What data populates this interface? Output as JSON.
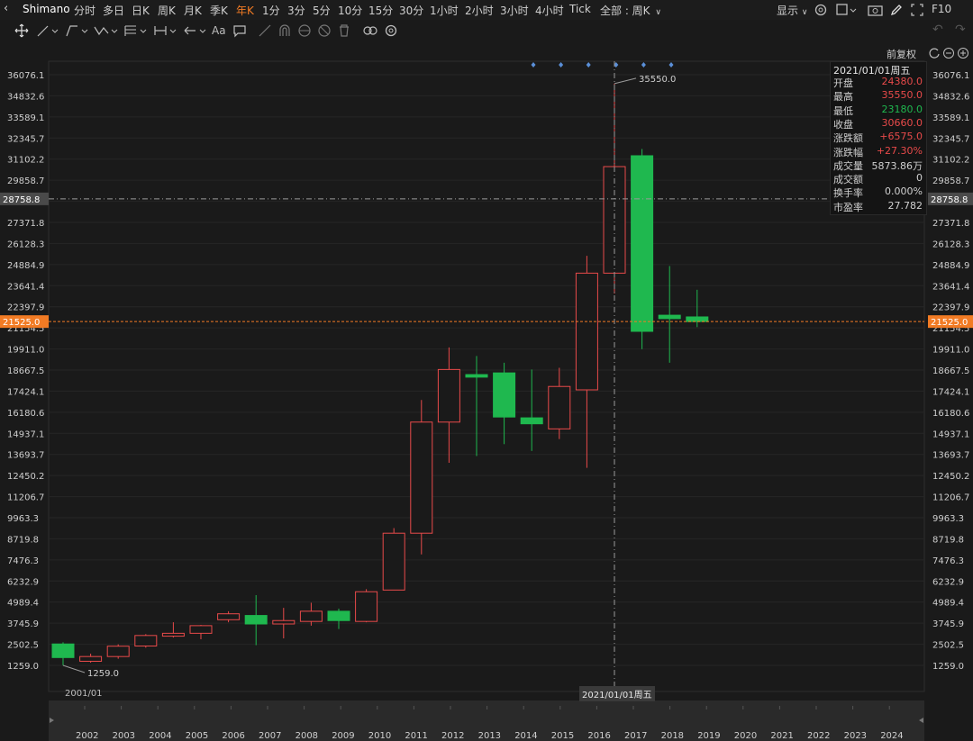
{
  "topbar": {
    "symbol": "Shimano",
    "timeframes": [
      "分时",
      "多日",
      "日K",
      "周K",
      "月K",
      "季K",
      "年K",
      "1分",
      "3分",
      "5分",
      "10分",
      "15分",
      "30分",
      "1小时",
      "2小时",
      "3小时",
      "4小时",
      "Tick"
    ],
    "active_timeframe": "年K",
    "range_label": "全部 : 周K",
    "display_label": "显示",
    "f10_label": "F10"
  },
  "toolbar": {
    "aa_label": "Aa"
  },
  "chart": {
    "adjust_label": "前复权",
    "high_marker_label": "35550.0",
    "low_marker_label": "1259.0",
    "crosshair_price": "28758.8",
    "last_price": "21525.0",
    "first_date_label": "2001/01",
    "crosshair_date": "2021/01/01周五"
  },
  "info_panel": {
    "date": "2021/01/01周五",
    "rows": [
      {
        "label": "开盘",
        "value": "24380.0",
        "color": "#e84a4a"
      },
      {
        "label": "最高",
        "value": "35550.0",
        "color": "#e84a4a"
      },
      {
        "label": "最低",
        "value": "23180.0",
        "color": "#1fb84f"
      },
      {
        "label": "收盘",
        "value": "30660.0",
        "color": "#e84a4a"
      },
      {
        "label": "涨跌额",
        "value": "+6575.0",
        "color": "#e84a4a"
      },
      {
        "label": "涨跌幅",
        "value": "+27.30%",
        "color": "#e84a4a"
      },
      {
        "label": "成交量",
        "value": "5873.86万",
        "color": "#d0d0d0"
      },
      {
        "label": "成交额",
        "value": "0",
        "color": "#d0d0d0"
      },
      {
        "label": "换手率",
        "value": "0.000%",
        "color": "#d0d0d0"
      },
      {
        "label": "市盈率",
        "value": "27.782",
        "color": "#d0d0d0"
      }
    ]
  },
  "chart_data": {
    "type": "candlestick",
    "title": "Shimano",
    "y_ticks": [
      36076.1,
      34832.6,
      33589.1,
      32345.7,
      31102.2,
      29858.7,
      28615.2,
      27371.8,
      26128.3,
      24884.9,
      23641.4,
      22397.9,
      21154.5,
      19911.0,
      18667.5,
      17424.1,
      16180.6,
      14937.1,
      13693.7,
      12450.2,
      11206.7,
      9963.3,
      8719.8,
      7476.3,
      6232.9,
      4989.4,
      3745.9,
      2502.5,
      1259.0
    ],
    "ylim": [
      1259.0,
      36076.1
    ],
    "x_labels": [
      "2002",
      "2003",
      "2004",
      "2005",
      "2006",
      "2007",
      "2008",
      "2009",
      "2010",
      "2011",
      "2012",
      "2013",
      "2014",
      "2015",
      "2016",
      "2017",
      "2018",
      "2019",
      "2020",
      "2021",
      "2022",
      "2023",
      "2024"
    ],
    "up_color": "#e84a4a",
    "down_color": "#1fb84f",
    "candles": [
      {
        "year": "2001",
        "open": 2520,
        "high": 2620,
        "low": 1259,
        "close": 1720
      },
      {
        "year": "2002",
        "open": 1500,
        "high": 1950,
        "low": 1420,
        "close": 1780
      },
      {
        "year": "2003",
        "open": 1780,
        "high": 2500,
        "low": 1650,
        "close": 2390
      },
      {
        "year": "2004",
        "open": 2400,
        "high": 3100,
        "low": 2300,
        "close": 3020
      },
      {
        "year": "2005",
        "open": 2980,
        "high": 3800,
        "low": 2900,
        "close": 3150
      },
      {
        "year": "2006",
        "open": 3150,
        "high": 3650,
        "low": 2800,
        "close": 3600
      },
      {
        "year": "2007",
        "open": 3950,
        "high": 4450,
        "low": 3800,
        "close": 4300
      },
      {
        "year": "2008",
        "open": 4200,
        "high": 5400,
        "low": 2450,
        "close": 3700
      },
      {
        "year": "2009",
        "open": 3700,
        "high": 4650,
        "low": 2850,
        "close": 3900
      },
      {
        "year": "2010",
        "open": 3850,
        "high": 4950,
        "low": 3600,
        "close": 4450
      },
      {
        "year": "2011",
        "open": 4450,
        "high": 4600,
        "low": 3400,
        "close": 3900
      },
      {
        "year": "2012",
        "open": 3850,
        "high": 5750,
        "low": 3800,
        "close": 5600
      },
      {
        "year": "2013",
        "open": 5700,
        "high": 9350,
        "low": 5700,
        "close": 9050
      },
      {
        "year": "2014",
        "open": 9050,
        "high": 16900,
        "low": 7800,
        "close": 15600
      },
      {
        "year": "2015",
        "open": 15600,
        "high": 20000,
        "low": 13200,
        "close": 18700
      },
      {
        "year": "2016",
        "open": 18400,
        "high": 19500,
        "low": 13600,
        "close": 18250
      },
      {
        "year": "2017",
        "open": 18500,
        "high": 19100,
        "low": 14300,
        "close": 15900
      },
      {
        "year": "2018",
        "open": 15850,
        "high": 18700,
        "low": 13900,
        "close": 15500
      },
      {
        "year": "2019",
        "open": 15200,
        "high": 18800,
        "low": 14600,
        "close": 17700
      },
      {
        "year": "2020",
        "open": 17500,
        "high": 25400,
        "low": 12900,
        "close": 24380
      },
      {
        "year": "2021",
        "open": 24380,
        "high": 35550,
        "low": 23180,
        "close": 30660
      },
      {
        "year": "2022",
        "open": 31300,
        "high": 31700,
        "low": 19900,
        "close": 20950
      },
      {
        "year": "2023",
        "open": 21900,
        "high": 24800,
        "low": 19100,
        "close": 21700
      },
      {
        "year": "2024",
        "open": 21800,
        "high": 23400,
        "low": 21200,
        "close": 21525
      }
    ]
  }
}
